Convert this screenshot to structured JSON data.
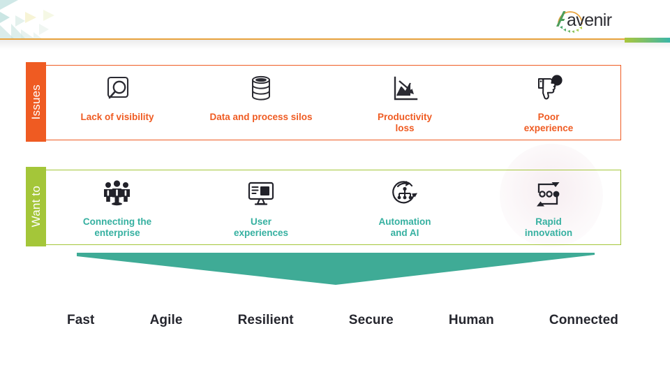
{
  "slide": {
    "background_color": "#ffffff",
    "header": {
      "rule_color": "#e8a33d",
      "accent_gradient_from": "#aac63c",
      "accent_gradient_to": "#3bb6a8",
      "logo_text": "Aavenir",
      "logo_mark": "arc-of-triangles-icon"
    }
  },
  "issues_row": {
    "tab_label": "Issues",
    "tab_color": "#ef5b22",
    "border_color": "#ef5b22",
    "text_color": "#ef5b22",
    "items": [
      {
        "icon": "magnifier-in-square-icon",
        "label": "Lack of visibility"
      },
      {
        "icon": "database-stack-icon",
        "label": "Data and process silos"
      },
      {
        "icon": "declining-chart-icon",
        "label": "Productivity\nloss"
      },
      {
        "icon": "thumbs-down-speech-bubble-icon",
        "label": "Poor\nexperience"
      }
    ]
  },
  "want_to_row": {
    "tab_label": "Want to",
    "tab_color": "#a4c639",
    "border_color": "#a4c639",
    "text_color": "#35b0a0",
    "items": [
      {
        "icon": "group-of-people-icon",
        "label": "Connecting the\nenterprise"
      },
      {
        "icon": "monitor-screen-icon",
        "label": "User\nexperiences"
      },
      {
        "icon": "automation-cycle-hierarchy-icon",
        "label": "Automation\nand AI"
      },
      {
        "icon": "rapid-loop-dots-icon",
        "label": "Rapid\ninnovation"
      }
    ]
  },
  "arrow": {
    "name": "down-arrow-banner",
    "color": "#3fab96"
  },
  "outcomes": {
    "text_color": "#25262e",
    "words": [
      "Fast",
      "Agile",
      "Resilient",
      "Secure",
      "Human",
      "Connected"
    ]
  }
}
